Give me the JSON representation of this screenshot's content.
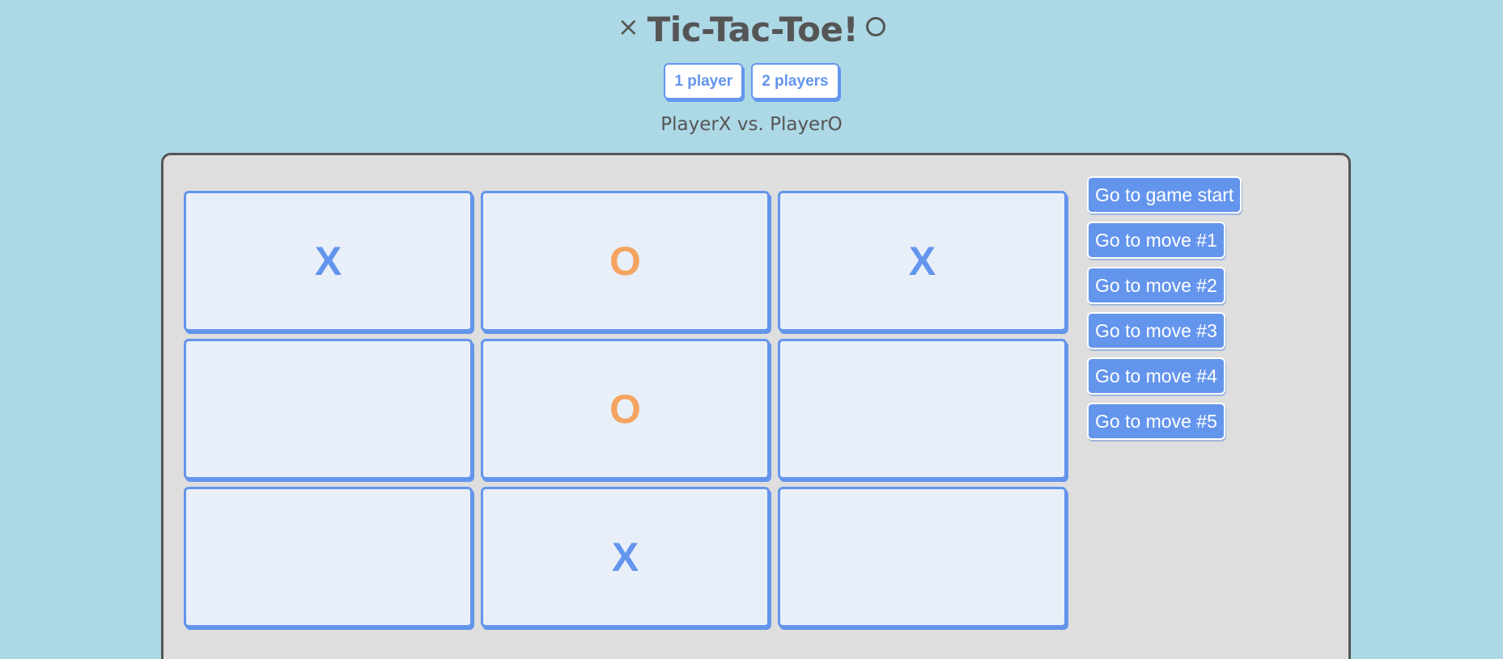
{
  "header": {
    "title": "Tic-Tac-Toe!",
    "title_left_icon": "x-mark-icon",
    "title_right_icon": "circle-icon"
  },
  "mode_buttons": [
    {
      "label": "1 player"
    },
    {
      "label": "2 players"
    }
  ],
  "players_line": "PlayerX vs. PlayerO",
  "board": {
    "cells": [
      "X",
      "O",
      "X",
      "",
      "O",
      "",
      "",
      "X",
      ""
    ]
  },
  "history": [
    {
      "label": "Go to game start"
    },
    {
      "label": "Go to move #1"
    },
    {
      "label": "Go to move #2"
    },
    {
      "label": "Go to move #3"
    },
    {
      "label": "Go to move #4"
    },
    {
      "label": "Go to move #5"
    }
  ],
  "colors": {
    "background": "#add8e6",
    "accent": "#6495ed",
    "o_mark": "#f4a460",
    "panel": "#dedede",
    "cell": "#e8eff9",
    "text": "#555555"
  }
}
